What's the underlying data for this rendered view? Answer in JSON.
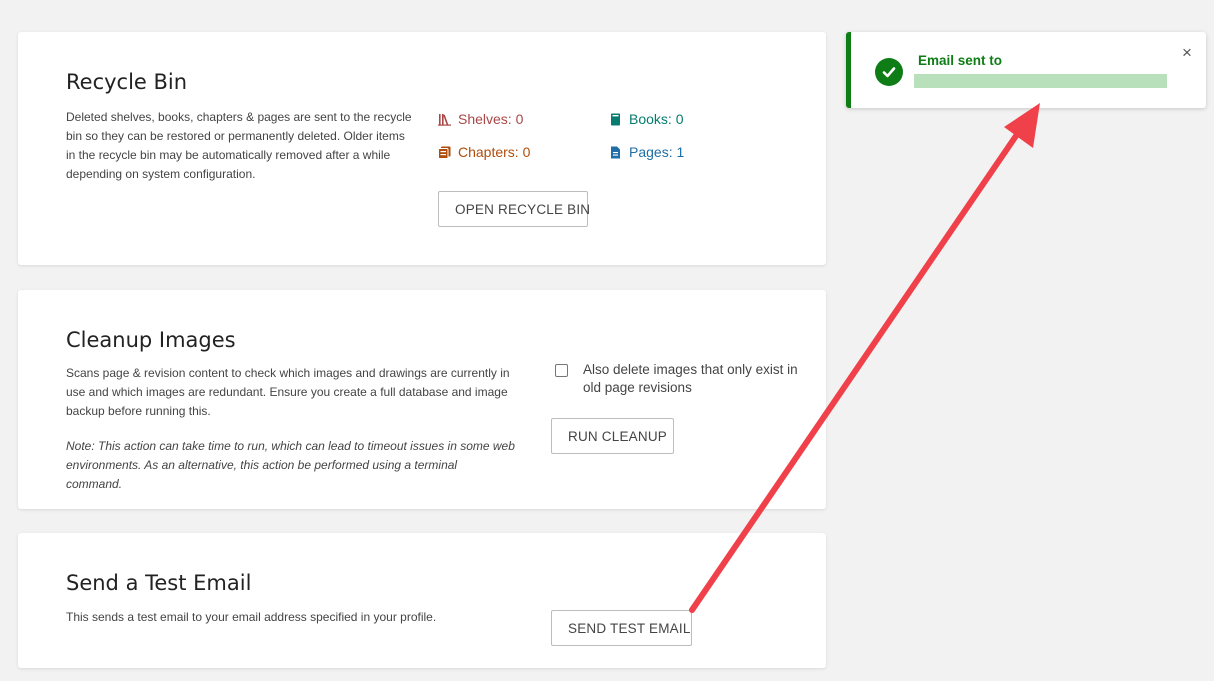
{
  "recycle_bin": {
    "title": "Recycle Bin",
    "description": "Deleted shelves, books, chapters & pages are sent to the recycle bin so they can be restored or permanently deleted. Older items in the recycle bin may be automatically removed after a while depending on system configuration.",
    "stats": {
      "shelves": "Shelves: 0",
      "books": "Books: 0",
      "chapters": "Chapters: 0",
      "pages": "Pages: 1"
    },
    "button_label": "OPEN RECYCLE BIN"
  },
  "cleanup_images": {
    "title": "Cleanup Images",
    "description": "Scans page & revision content to check which images and drawings are currently in use and which images are redundant. Ensure you create a full database and image backup before running this.",
    "note": "Note: This action can take time to run, which can lead to timeout issues in some web environments. As an alternative, this action be performed using a terminal command.",
    "checkbox_label": "Also delete images that only exist in old page revisions",
    "button_label": "RUN CLEANUP"
  },
  "test_email": {
    "title": "Send a Test Email",
    "description": "This sends a test email to your email address specified in your profile.",
    "button_label": "SEND TEST EMAIL"
  },
  "toast": {
    "title": "Email sent to",
    "close": "×"
  },
  "colors": {
    "shelves": "#a94747",
    "books": "#077b70",
    "chapters": "#af4d0d",
    "pages": "#206ea7",
    "success": "#0f7d15",
    "arrow": "#f0414a"
  },
  "icons": {
    "shelves": "shelves-icon",
    "books": "book-icon",
    "chapters": "chapter-icon",
    "pages": "page-icon",
    "toast": "check-circle-icon",
    "close": "close-icon"
  }
}
